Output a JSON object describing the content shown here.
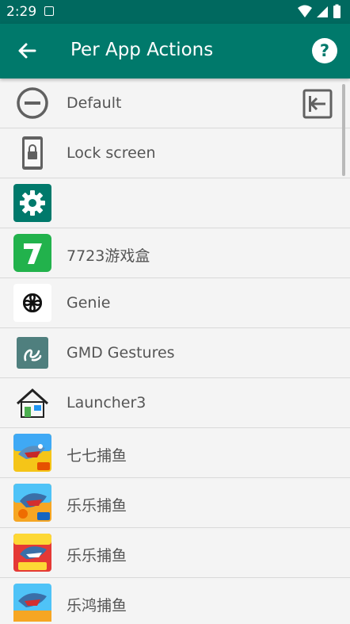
{
  "status_bar": {
    "time": "2:29"
  },
  "app_bar": {
    "title": "Per App Actions"
  },
  "colors": {
    "primary": "#00796b",
    "primary_dark": "#00695f",
    "text": "#555555"
  },
  "items": [
    {
      "label": "Default",
      "icon": "no-entry-icon",
      "trailing": "import-icon"
    },
    {
      "label": "Lock screen",
      "icon": "lock-phone-icon"
    },
    {
      "label": "",
      "icon": "settings-app-icon"
    },
    {
      "label": "7723游戏盒",
      "icon": "app-7723-icon"
    },
    {
      "label": "Genie",
      "icon": "genie-app-icon"
    },
    {
      "label": "GMD Gestures",
      "icon": "gmd-gestures-icon"
    },
    {
      "label": "Launcher3",
      "icon": "launcher-home-icon"
    },
    {
      "label": "七七捕鱼",
      "icon": "fishing-game-icon"
    },
    {
      "label": "乐乐捕鱼",
      "icon": "fishing-game-icon"
    },
    {
      "label": "乐乐捕鱼",
      "icon": "fishing-game-icon"
    },
    {
      "label": "乐鸿捕鱼",
      "icon": "fishing-game-icon"
    }
  ]
}
